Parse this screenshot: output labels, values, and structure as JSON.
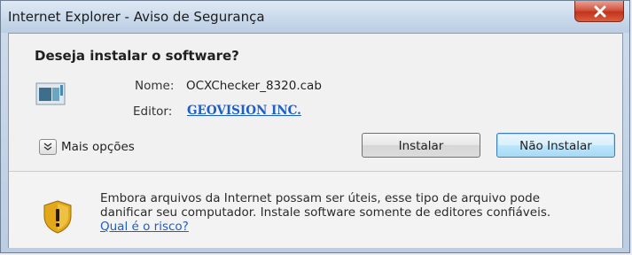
{
  "window": {
    "title": "Internet Explorer - Aviso de Segurança"
  },
  "dialog": {
    "heading": "Deseja instalar o software?",
    "name_label": "Nome:",
    "name_value": "OCXChecker_8320.cab",
    "editor_label": "Editor:",
    "editor_value": "GEOVISION INC.",
    "more_options_label": "Mais opções",
    "install_button": "Instalar",
    "no_install_button": "Não Instalar"
  },
  "warning": {
    "line1": "Embora arquivos da Internet possam ser úteis, esse tipo de arquivo pode",
    "line2": "danificar seu computador. Instale software somente de editores confiáveis.",
    "link": "Qual é o risco?"
  },
  "icons": {
    "close": "close-icon",
    "file": "cab-file-icon",
    "expand": "expand-chevron-icon",
    "warning": "shield-warning-icon"
  },
  "colors": {
    "link": "#1c5ec9",
    "close_button": "#c2331c",
    "shield": "#e3a81a"
  }
}
